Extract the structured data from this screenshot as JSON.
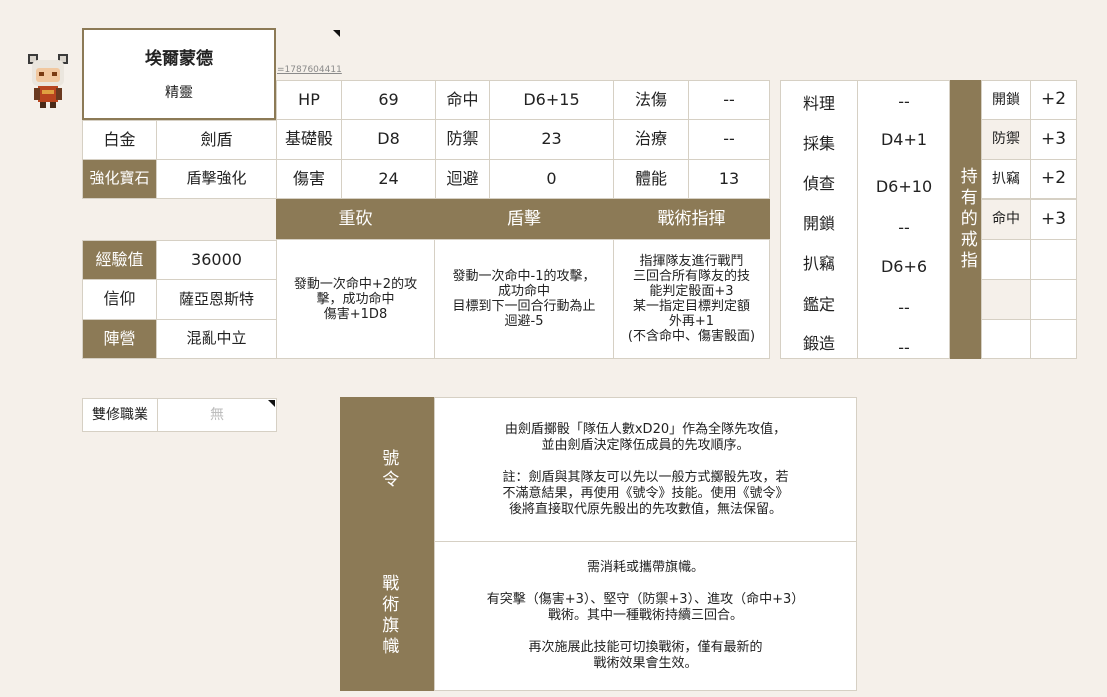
{
  "character": {
    "name": "埃爾蒙德",
    "race": "精靈",
    "id_text": "=1787604411"
  },
  "rank": {
    "left": "白金",
    "right": "劍盾"
  },
  "gem": {
    "label": "強化寶石",
    "value": "盾擊強化"
  },
  "exp": {
    "label": "經驗值",
    "value": "36000"
  },
  "faith": {
    "label": "信仰",
    "value": "薩亞恩斯特"
  },
  "alignment": {
    "label": "陣營",
    "value": "混亂中立"
  },
  "stats": {
    "hp_label": "HP",
    "hp_value": "69",
    "base_die_label": "基礎骰",
    "base_die_value": "D8",
    "damage_label": "傷害",
    "damage_value": "24",
    "hit_label": "命中",
    "hit_value": "D6+15",
    "defense_label": "防禦",
    "defense_value": "23",
    "evade_label": "迴避",
    "evade_value": "0",
    "magic_label": "法傷",
    "magic_value": "--",
    "heal_label": "治療",
    "heal_value": "--",
    "stamina_label": "體能",
    "stamina_value": "13"
  },
  "skills": [
    {
      "name": "重砍",
      "desc": "發動一次命中+2的攻\n擊，成功命中\n傷害+1D8"
    },
    {
      "name": "盾擊",
      "desc": "發動一次命中-1的攻擊，\n成功命中\n目標到下一回合行動為止\n迴避-5"
    },
    {
      "name": "戰術指揮",
      "desc": "指揮隊友進行戰鬥\n三回合所有隊友的技\n能判定骰面+3\n某一指定目標判定額\n外再+1\n(不含命中、傷害骰面)"
    }
  ],
  "life_skills": [
    {
      "label": "料理",
      "value": "--"
    },
    {
      "label": "採集",
      "value": "D4+1"
    },
    {
      "label": "偵查",
      "value": "D6+10"
    },
    {
      "label": "開鎖",
      "value": "--"
    },
    {
      "label": "扒竊",
      "value": "D6+6"
    },
    {
      "label": "鑑定",
      "value": "--"
    },
    {
      "label": "鍛造",
      "value": "--"
    }
  ],
  "rings": {
    "title": "持有的戒指",
    "items": [
      {
        "label": "開鎖",
        "value": "+2"
      },
      {
        "label": "防禦",
        "value": "+3"
      },
      {
        "label": "扒竊",
        "value": "+2"
      },
      {
        "label": "命中",
        "value": "+3"
      }
    ]
  },
  "dual_class": {
    "label": "雙修職業",
    "value": "無"
  },
  "abilities": [
    {
      "name": "號令",
      "desc": "由劍盾擲骰「隊伍人數xD20」作為全隊先攻值，\n並由劍盾決定隊伍成員的先攻順序。\n\n註：劍盾與其隊友可以先以一般方式擲骰先攻，若\n不滿意結果，再使用《號令》技能。使用《號令》\n後將直接取代原先骰出的先攻數值，無法保留。"
    },
    {
      "name": "戰術旗幟",
      "desc": "需消耗或攜帶旗幟。\n\n有突擊（傷害+3）、堅守（防禦+3）、進攻（命中+3）\n戰術。其中一種戰術持續三回合。\n\n再次施展此技能可切換戰術，僅有最新的\n戰術效果會生效。"
    }
  ],
  "colors": {
    "brown": "#8c7a56",
    "background": "#f5f0ea",
    "border": "#d6d0c4"
  }
}
